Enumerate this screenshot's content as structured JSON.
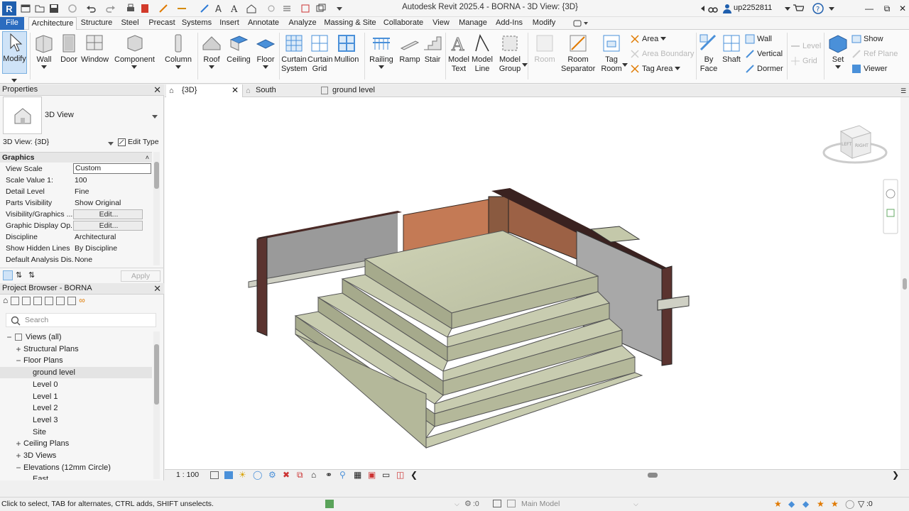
{
  "titlebar": {
    "title": "Autodesk Revit 2025.4 - BORNA - 3D View: {3D}",
    "user": "up2252811",
    "logo_letter": "R"
  },
  "ribbon_tabs": [
    "File",
    "Architecture",
    "Structure",
    "Steel",
    "Precast",
    "Systems",
    "Insert",
    "Annotate",
    "Analyze",
    "Massing & Site",
    "Collaborate",
    "View",
    "Manage",
    "Add-Ins",
    "Modify"
  ],
  "ribbon": {
    "modify": "Modify",
    "wall": "Wall",
    "door": "Door",
    "window": "Window",
    "component": "Component",
    "column": "Column",
    "roof": "Roof",
    "ceiling": "Ceiling",
    "floor": "Floor",
    "curtain_system": [
      "Curtain",
      "System"
    ],
    "curtain_grid": [
      "Curtain",
      "Grid"
    ],
    "mullion": "Mullion",
    "railing": "Railing",
    "ramp": "Ramp",
    "stair": "Stair",
    "model_text": [
      "Model",
      "Text"
    ],
    "model_line": [
      "Model",
      "Line"
    ],
    "model_group": [
      "Model",
      "Group"
    ],
    "room": "Room",
    "room_separator": [
      "Room",
      "Separator"
    ],
    "tag_room": [
      "Tag",
      "Room"
    ],
    "area": "Area",
    "area_boundary": "Area  Boundary",
    "tag_area": "Tag  Area",
    "by_face": [
      "By",
      "Face"
    ],
    "shaft": "Shaft",
    "wall_small": "Wall",
    "vertical": "Vertical",
    "dormer": "Dormer",
    "level": "Level",
    "grid": "Grid",
    "set": "Set",
    "show": "Show",
    "ref_plane": "Ref  Plane",
    "viewer": "Viewer"
  },
  "properties": {
    "header": "Properties",
    "type_name": "3D View",
    "instance_selector": "3D View: {3D}",
    "edit_type": "Edit Type",
    "group": "Graphics",
    "rows": [
      {
        "k": "View Scale",
        "v": "Custom",
        "style": "box"
      },
      {
        "k": "Scale Value    1:",
        "v": "100",
        "style": ""
      },
      {
        "k": "Detail Level",
        "v": "Fine",
        "style": ""
      },
      {
        "k": "Parts Visibility",
        "v": "Show Original",
        "style": ""
      },
      {
        "k": "Visibility/Graphics ...",
        "v": "Edit...",
        "style": "btn"
      },
      {
        "k": "Graphic Display Op...",
        "v": "Edit...",
        "style": "btn"
      },
      {
        "k": "Discipline",
        "v": "Architectural",
        "style": ""
      },
      {
        "k": "Show Hidden Lines",
        "v": "By Discipline",
        "style": ""
      },
      {
        "k": "Default Analysis Dis...",
        "v": "None",
        "style": ""
      }
    ],
    "apply": "Apply"
  },
  "browser": {
    "header": "Project Browser - BORNA",
    "search_placeholder": "Search",
    "items": [
      {
        "label": "Views (all)",
        "indent": 0,
        "exp": "−",
        "icon": true
      },
      {
        "label": "Structural Plans",
        "indent": 1,
        "exp": "+"
      },
      {
        "label": "Floor Plans",
        "indent": 1,
        "exp": "−"
      },
      {
        "label": "ground level",
        "indent": 2,
        "exp": "",
        "selected": true
      },
      {
        "label": "Level 0",
        "indent": 2,
        "exp": ""
      },
      {
        "label": "Level 1",
        "indent": 2,
        "exp": ""
      },
      {
        "label": "Level 2",
        "indent": 2,
        "exp": ""
      },
      {
        "label": "Level 3",
        "indent": 2,
        "exp": ""
      },
      {
        "label": "Site",
        "indent": 2,
        "exp": ""
      },
      {
        "label": "Ceiling Plans",
        "indent": 1,
        "exp": "+"
      },
      {
        "label": "3D Views",
        "indent": 1,
        "exp": "+"
      },
      {
        "label": "Elevations (12mm Circle)",
        "indent": 1,
        "exp": "−"
      },
      {
        "label": "East",
        "indent": 2,
        "exp": ""
      }
    ]
  },
  "view_tabs": [
    {
      "label": "{3D}",
      "active": true
    },
    {
      "label": "South",
      "active": false
    },
    {
      "label": "ground level",
      "active": false
    }
  ],
  "viewcube": {
    "left": "LEFT",
    "right": "RIGHT"
  },
  "view_control": {
    "scale": "1 : 100"
  },
  "status": {
    "message": "Click to select, TAB for alternates, CTRL adds, SHIFT unselects.",
    "workset_count": ":0",
    "model": "Main Model",
    "filter_count": ":0"
  },
  "colors": {
    "file_tab": "#2b6cbf",
    "wall_brick": "#6b3a35",
    "wall_copper": "#c47a55",
    "stair_concrete": "#c4c8aa"
  }
}
